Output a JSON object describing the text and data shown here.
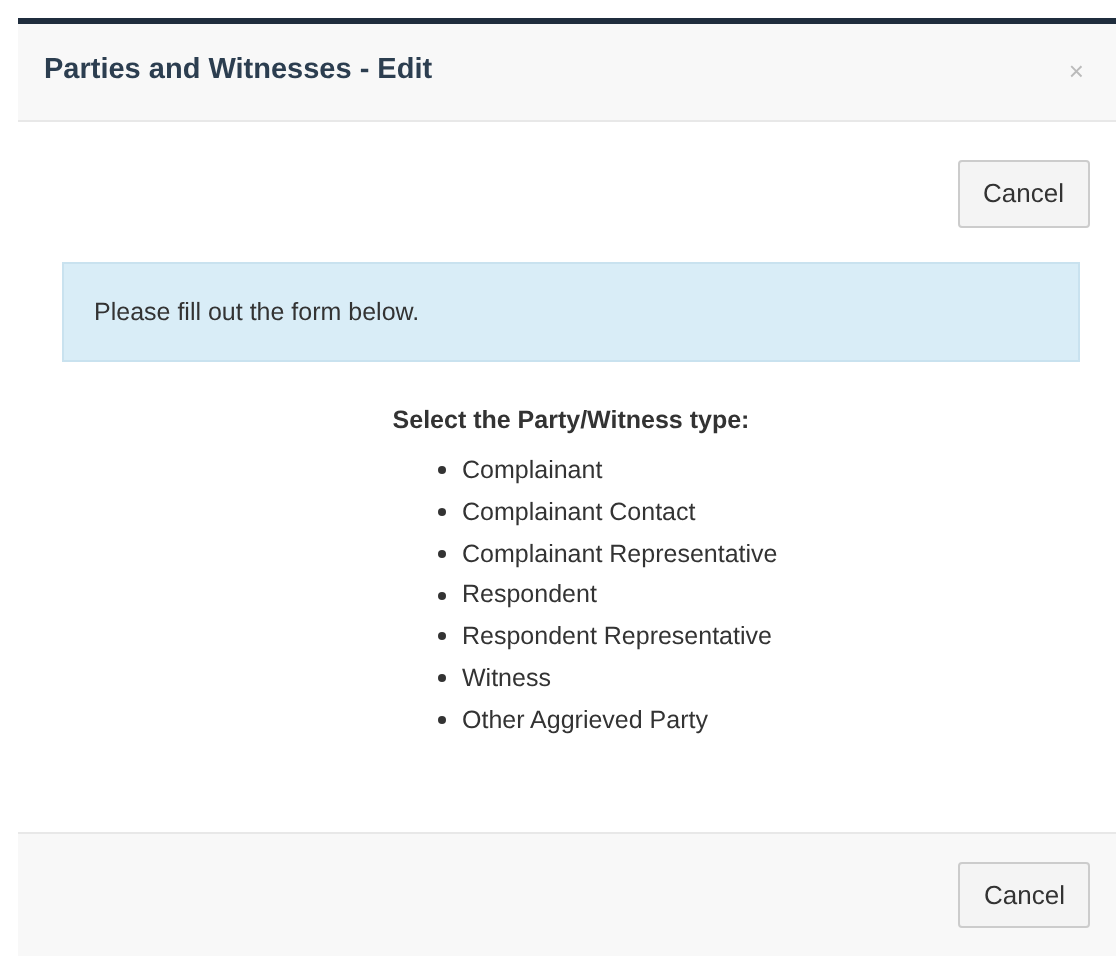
{
  "dialog": {
    "title": "Parties and Witnesses - Edit",
    "close": "×"
  },
  "top_buttons": [
    "Cancel"
  ],
  "alert": "Please fill out the form below.",
  "prompt": "Select the Party/Witness type:",
  "party_types": [
    {
      "label": "Complainant"
    },
    {
      "label": "Complainant Contact"
    },
    {
      "label": "Complainant Representative"
    },
    {
      "label": "Respondent"
    },
    {
      "label": "Respondent Representative"
    },
    {
      "label": "Witness"
    },
    {
      "label": "Other Aggrieved Party"
    }
  ],
  "footer_buttons": [
    "Cancel"
  ]
}
